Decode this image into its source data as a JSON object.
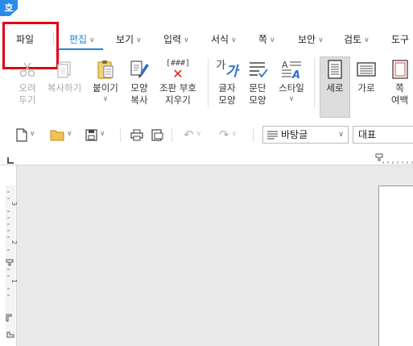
{
  "app": {
    "badge": "호"
  },
  "menu": {
    "file": "파일",
    "items": [
      {
        "label": "편집",
        "active": true
      },
      {
        "label": "보기"
      },
      {
        "label": "입력"
      },
      {
        "label": "서식"
      },
      {
        "label": "쪽"
      },
      {
        "label": "보안"
      },
      {
        "label": "검토"
      },
      {
        "label": "도구"
      }
    ]
  },
  "ribbon": {
    "cut": {
      "line1": "오려",
      "line2": "두기"
    },
    "copy": {
      "line1": "복사하기"
    },
    "paste": {
      "line1": "붙이기"
    },
    "format_copy": {
      "line1": "모양",
      "line2": "복사"
    },
    "clear_marks": {
      "line1": "조판 부호",
      "line2": "지우기",
      "icon_text": "[###]"
    },
    "char_shape": {
      "line1": "글자",
      "line2": "모양",
      "icon_text": "가"
    },
    "para_shape": {
      "line1": "문단",
      "line2": "모양"
    },
    "style": {
      "line1": "스타일",
      "icon_text": "A"
    },
    "portrait": {
      "line1": "세로"
    },
    "landscape": {
      "line1": "가로"
    },
    "margins": {
      "line1": "쪽",
      "line2": "여백"
    }
  },
  "toolbar": {
    "style_value": "바탕글",
    "font_value": "대표"
  },
  "ruler": {
    "v_numbers": [
      "3",
      "2",
      "1"
    ]
  },
  "colors": {
    "accent": "#1f86d8",
    "highlight": "#e00012",
    "badge": "#2a8be6"
  }
}
